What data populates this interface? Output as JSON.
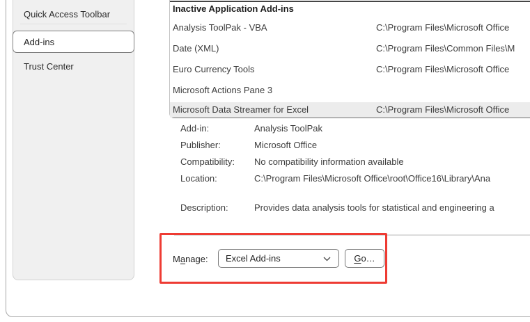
{
  "colors": {
    "annotation_red": "#ee3b33",
    "sidebar_bg": "#f0f0f0",
    "row_highlight": "#ececec"
  },
  "sidebar": {
    "selected": "Add-ins",
    "items": [
      {
        "label": "Quick Access Toolbar"
      },
      {
        "label": "Add-ins"
      },
      {
        "label": "Trust Center"
      }
    ]
  },
  "addins": {
    "section_header": "Inactive Application Add-ins",
    "rows": [
      {
        "name": "Analysis ToolPak - VBA",
        "location": "C:\\Program Files\\Microsoft Office"
      },
      {
        "name": "Date (XML)",
        "location": "C:\\Program Files\\Common Files\\M"
      },
      {
        "name": "Euro Currency Tools",
        "location": "C:\\Program Files\\Microsoft Office"
      },
      {
        "name": "Microsoft Actions Pane 3",
        "location": ""
      },
      {
        "name": "Microsoft Data Streamer for Excel",
        "location": "C:\\Program Files\\Microsoft Office"
      }
    ],
    "highlighted_row": "Microsoft Data Streamer for Excel"
  },
  "details": {
    "rows": [
      {
        "label": "Add-in:",
        "value": "Analysis ToolPak"
      },
      {
        "label": "Publisher:",
        "value": "Microsoft Office"
      },
      {
        "label": "Compatibility:",
        "value": "No compatibility information available"
      },
      {
        "label": "Location:",
        "value": "C:\\Program Files\\Microsoft Office\\root\\Office16\\Library\\Ana"
      },
      {
        "label": "Description:",
        "value": "Provides data analysis tools for statistical and engineering a"
      }
    ]
  },
  "manage": {
    "label_prefix": "M",
    "label_accel": "a",
    "label_suffix": "nage:",
    "dropdown_value": "Excel Add-ins",
    "go_accel": "G",
    "go_suffix": "o…"
  },
  "icons": {
    "chevron_down": "⌄"
  }
}
